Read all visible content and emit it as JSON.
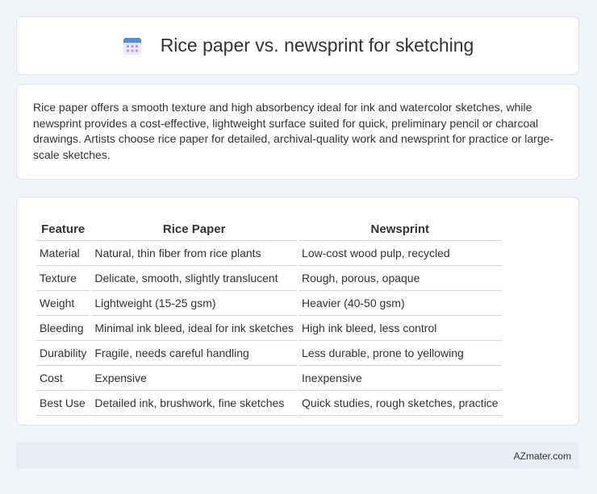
{
  "header": {
    "icon": "calendar-icon",
    "title": "Rice paper vs. newsprint for sketching"
  },
  "summary": {
    "text": "Rice paper offers a smooth texture and high absorbency ideal for ink and watercolor sketches, while newsprint provides a cost-effective, lightweight surface suited for quick, preliminary pencil or charcoal drawings. Artists choose rice paper for detailed, archival-quality work and newsprint for practice or large-scale sketches."
  },
  "table": {
    "headers": [
      "Feature",
      "Rice Paper",
      "Newsprint"
    ],
    "rows": [
      [
        "Material",
        "Natural, thin fiber from rice plants",
        "Low-cost wood pulp, recycled"
      ],
      [
        "Texture",
        "Delicate, smooth, slightly translucent",
        "Rough, porous, opaque"
      ],
      [
        "Weight",
        "Lightweight (15-25 gsm)",
        "Heavier (40-50 gsm)"
      ],
      [
        "Bleeding",
        "Minimal ink bleed, ideal for ink sketches",
        "High ink bleed, less control"
      ],
      [
        "Durability",
        "Fragile, needs careful handling",
        "Less durable, prone to yellowing"
      ],
      [
        "Cost",
        "Expensive",
        "Inexpensive"
      ],
      [
        "Best Use",
        "Detailed ink, brushwork, fine sketches",
        "Quick studies, rough sketches, practice"
      ]
    ]
  },
  "footer": {
    "brand": "AZmater.com"
  },
  "colors": {
    "background": "#f1f4f9",
    "card": "#ffffff",
    "footer": "#e9eef6",
    "icon_accent": "#4a8df0",
    "icon_grid": "#b79be6"
  }
}
